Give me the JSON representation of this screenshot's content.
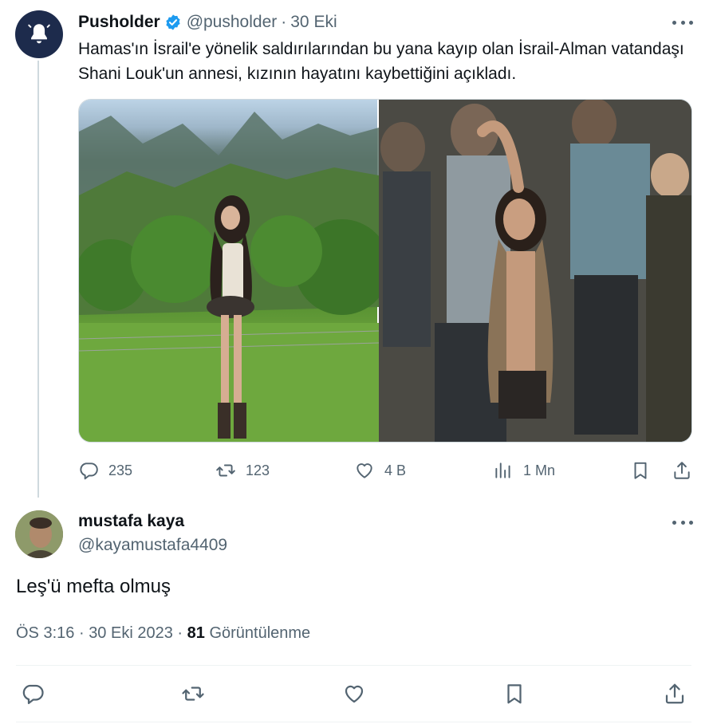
{
  "tweet": {
    "author_name": "Pusholder",
    "verified": true,
    "handle": "@pusholder",
    "separator": "·",
    "date": "30 Eki",
    "text": "Hamas'ın İsrail'e yönelik saldırılarından bu yana kayıp olan İsrail-Alman vatandaşı Shani Louk'un annesi, kızının hayatını kaybettiğini açıkladı.",
    "avatar_icon": "bell-icon",
    "stats": {
      "replies": "235",
      "retweets": "123",
      "likes": "4 B",
      "views": "1 Mn"
    }
  },
  "reply": {
    "author_name": "mustafa kaya",
    "handle": "@kayamustafa4409",
    "text": "Leş'ü mefta olmuş",
    "time": "ÖS 3:16",
    "separator": "·",
    "date": "30 Eki 2023",
    "separator2": "·",
    "views_count": "81",
    "views_label": "Görüntülenme"
  },
  "colors": {
    "text_primary": "#0f1419",
    "text_secondary": "#536471",
    "verified_blue": "#1d9bf0",
    "border": "#cfd9de",
    "avatar_bg": "#1d2b4c"
  }
}
